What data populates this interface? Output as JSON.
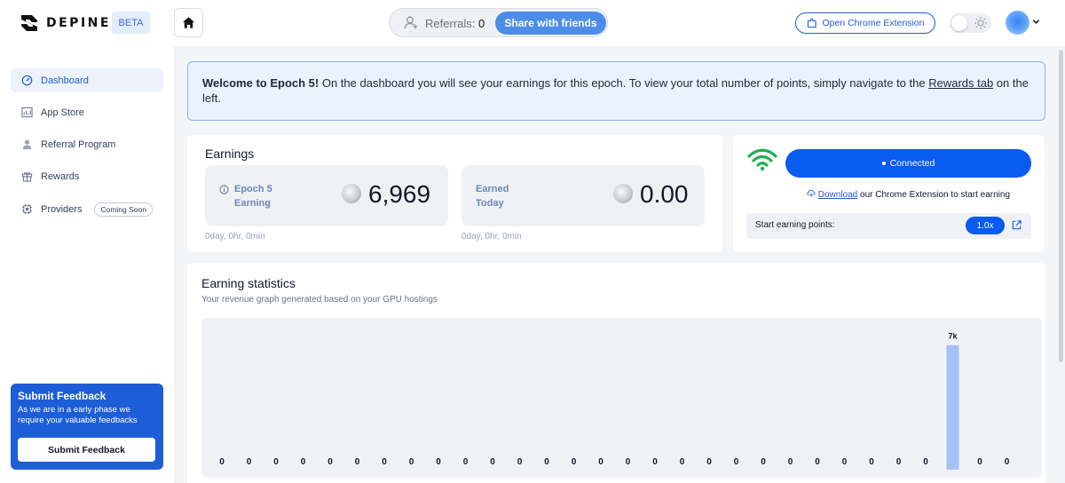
{
  "header": {
    "brand": "DEPINED",
    "beta_badge": "BETA",
    "referrals_label": "Referrals:",
    "referrals_count": "0",
    "share_label": "Share with friends",
    "chrome_ext_label": "Open Chrome Extension",
    "theme_mode": "light"
  },
  "sidebar": {
    "items": [
      {
        "label": "Dashboard",
        "icon": "dashboard-icon",
        "active": true
      },
      {
        "label": "App Store",
        "icon": "chart-icon"
      },
      {
        "label": "Referral Program",
        "icon": "person-icon"
      },
      {
        "label": "Rewards",
        "icon": "gift-icon"
      },
      {
        "label": "Providers",
        "icon": "cpu-icon",
        "badge": "Coming Soon"
      }
    ],
    "feedback": {
      "title": "Submit Feedback",
      "text": "As we are in a early phase we require your valuable feedbacks",
      "button": "Submit Feedback"
    }
  },
  "welcome": {
    "title": "Welcome to Epoch 5!",
    "text_before_link": " On the dashboard you will see your earnings for this epoch. To view your total number of points, simply navigate to the ",
    "link": "Rewards tab",
    "text_after_link": " on the left."
  },
  "earnings": {
    "title": "Earnings",
    "epoch": {
      "label_line1": "Epoch 5",
      "label_line2": "Earning",
      "value": "6,969",
      "time": "0day, 0hr, 0min"
    },
    "today": {
      "label_line1": "Earned",
      "label_line2": "Today",
      "value": "0.00",
      "time": "0day, 0hr, 0min"
    }
  },
  "connection": {
    "status": "Connected",
    "download_link": "Download",
    "download_text": " our Chrome Extension to start earning",
    "points_label": "Start earning points:",
    "multiplier": "1.0x",
    "colors": {
      "accent": "#0a5bf0",
      "wifi": "#22b14c"
    }
  },
  "stats": {
    "title": "Earning statistics",
    "subtitle": "Your revenue graph generated based on your GPU hostings"
  },
  "chart_data": {
    "type": "bar",
    "title": "",
    "xlabel": "",
    "ylabel": "",
    "values": [
      0,
      0,
      0,
      0,
      0,
      0,
      0,
      0,
      0,
      0,
      0,
      0,
      0,
      0,
      0,
      0,
      0,
      0,
      0,
      0,
      0,
      0,
      0,
      0,
      0,
      0,
      0,
      6969,
      0,
      0
    ],
    "data_labels": [
      "0",
      "0",
      "0",
      "0",
      "0",
      "0",
      "0",
      "0",
      "0",
      "0",
      "0",
      "0",
      "0",
      "0",
      "0",
      "0",
      "0",
      "0",
      "0",
      "0",
      "0",
      "0",
      "0",
      "0",
      "0",
      "0",
      "0",
      "7k",
      "0",
      "0"
    ],
    "ylim": [
      0,
      7300
    ],
    "bar_color": "#a3c2f5",
    "grid": false
  }
}
